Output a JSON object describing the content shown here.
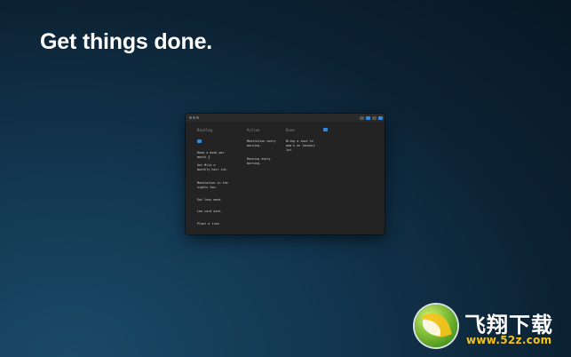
{
  "headline": "Get things done.",
  "window": {
    "columns": [
      {
        "title": "Backlog",
        "cards": [
          "Read a book per month.",
          "Get Milo a monthly hair cut.",
          "Meditation in the nights too.",
          "Eat less meat.",
          "Lee card diet.",
          "Plant a tree."
        ]
      },
      {
        "title": "Active",
        "cards": [
          "Meditation every morning.",
          "Running every morning."
        ]
      },
      {
        "title": "Done",
        "cards": [
          "Bring a vase to mom's on January 1st."
        ]
      }
    ]
  },
  "watermark": {
    "title": "飞翔下载",
    "url": "www.52z.com"
  },
  "colors": {
    "accent": "#2e8de0",
    "window_bg": "#232323",
    "text": "#cfcfcf",
    "logo_yellow": "#f4c21a",
    "logo_green": "#8ec63f"
  }
}
